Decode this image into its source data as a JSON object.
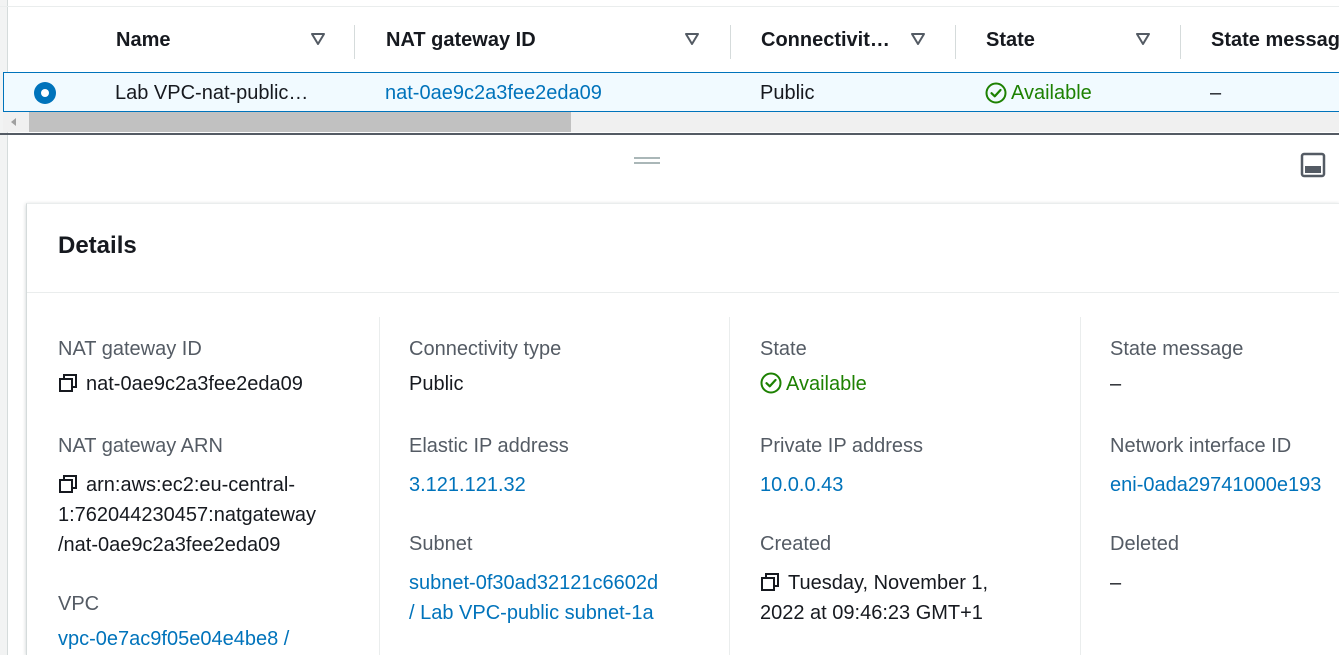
{
  "table": {
    "columns": [
      {
        "label": "Name"
      },
      {
        "label": "NAT gateway ID"
      },
      {
        "label": "Connectivit…"
      },
      {
        "label": "State"
      },
      {
        "label": "State messag"
      }
    ],
    "rows": [
      {
        "selected": true,
        "name": "Lab VPC-nat-public…",
        "nat_gateway_id": "nat-0ae9c2a3fee2eda09",
        "connectivity": "Public",
        "state": "Available",
        "state_message": "–"
      }
    ]
  },
  "details": {
    "title": "Details",
    "fields": {
      "nat_gateway_id": {
        "label": "NAT gateway ID",
        "value": "nat-0ae9c2a3fee2eda09"
      },
      "nat_gateway_arn": {
        "label": "NAT gateway ARN",
        "line1": "arn:aws:ec2:eu-central-",
        "line2": "1:762044230457:natgateway",
        "line3": "/nat-0ae9c2a3fee2eda09"
      },
      "vpc": {
        "label": "VPC",
        "value": "vpc-0e7ac9f05e04e4be8 /"
      },
      "connectivity_type": {
        "label": "Connectivity type",
        "value": "Public"
      },
      "elastic_ip": {
        "label": "Elastic IP address",
        "value": "3.121.121.32"
      },
      "subnet": {
        "label": "Subnet",
        "line1": "subnet-0f30ad32121c6602d",
        "line2": "/ Lab VPC-public subnet-1a"
      },
      "state": {
        "label": "State",
        "value": "Available"
      },
      "private_ip": {
        "label": "Private IP address",
        "value": "10.0.0.43"
      },
      "created": {
        "label": "Created",
        "line1": "Tuesday, November 1,",
        "line2": "2022 at 09:46:23 GMT+1"
      },
      "state_message": {
        "label": "State message",
        "value": "–"
      },
      "network_interface": {
        "label": "Network interface ID",
        "value": "eni-0ada29741000e193"
      },
      "deleted": {
        "label": "Deleted",
        "value": "–"
      }
    }
  },
  "colors": {
    "link": "#0073bb",
    "success": "#1d8102",
    "selected_row_bg": "#f1faff"
  },
  "icons": [
    "sort-caret-icon",
    "radio-selected-icon",
    "status-available-icon",
    "copy-icon",
    "panel-toggle-icon",
    "drag-handle-icon"
  ]
}
